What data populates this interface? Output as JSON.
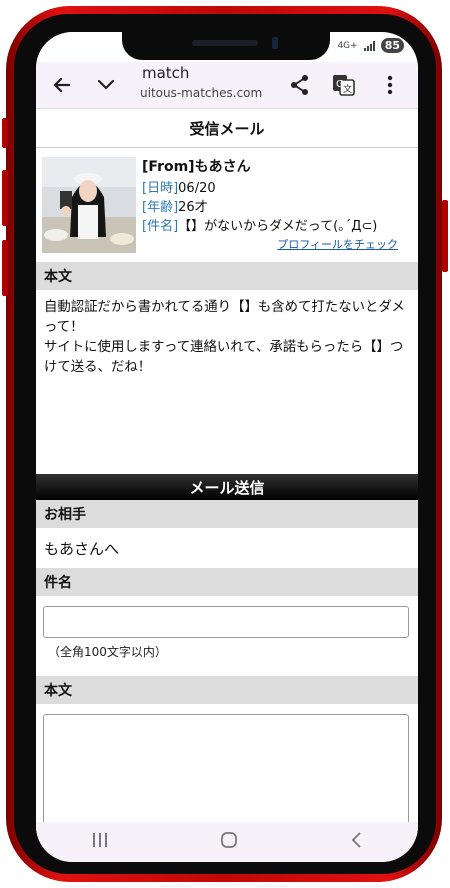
{
  "status": {
    "network": "4G+",
    "battery": "85"
  },
  "browser": {
    "title": "match",
    "url": "uitous-matches.com"
  },
  "page": {
    "heading": "受信メール"
  },
  "profile": {
    "from": "[From]もあさん",
    "date_label": "[日時]",
    "date": "06/20",
    "age_label": "[年齢]",
    "age": "26才",
    "subject_label": "[件名]",
    "subject": "【】がないからダメだって(｡´Д⊂)",
    "profile_link": "プロフィールをチェック"
  },
  "message": {
    "section_label": "本文",
    "lines": [
      "自動認証だから書かれてる通り【】も含めて打たないとダメって！",
      "サイトに使用しますって連絡いれて、承諾もらったら【】つけて送る、だね！"
    ]
  },
  "compose": {
    "title": "メール送信",
    "recipient_label": "お相手",
    "recipient": "もあさんへ",
    "subject_label": "件名",
    "subject_value": "",
    "subject_note": "（全角100文字以内）",
    "body_label": "本文",
    "body_value": ""
  },
  "colors": {
    "frame": "#d01010",
    "label_blue": "#2f79b8",
    "section_gray": "#dcdcdc"
  }
}
